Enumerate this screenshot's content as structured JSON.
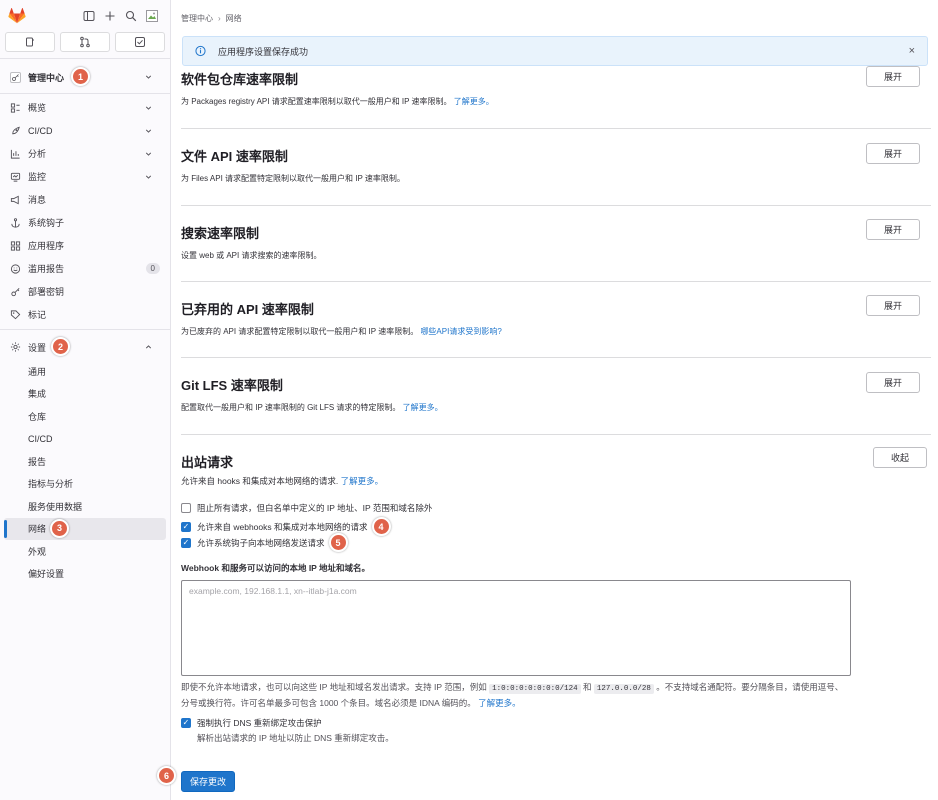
{
  "sidebar": {
    "top_icons": [
      "sidebar-toggle-icon",
      "plus-icon",
      "search-icon",
      "avatar"
    ],
    "quick_buttons": [
      "issues-icon",
      "merge-request-icon",
      "todo-icon"
    ],
    "admin": {
      "label": "管理中心",
      "marker": "1"
    },
    "items": [
      {
        "label": "概览",
        "icon": "overview-icon",
        "chevron": true
      },
      {
        "label": "CI/CD",
        "icon": "rocket-icon",
        "chevron": true
      },
      {
        "label": "分析",
        "icon": "chart-icon",
        "chevron": true
      },
      {
        "label": "监控",
        "icon": "monitor-icon",
        "chevron": true
      },
      {
        "label": "消息",
        "icon": "bullhorn-icon"
      },
      {
        "label": "系统钩子",
        "icon": "anchor-icon"
      },
      {
        "label": "应用程序",
        "icon": "applications-icon"
      },
      {
        "label": "滥用报告",
        "icon": "slight-smile-icon",
        "count": "0"
      },
      {
        "label": "部署密钥",
        "icon": "key-icon"
      },
      {
        "label": "标记",
        "icon": "label-icon"
      }
    ],
    "settings": {
      "label": "设置",
      "marker": "2"
    },
    "settings_items": [
      "通用",
      "集成",
      "仓库",
      "CI/CD",
      "报告",
      "指标与分析",
      "服务使用数据",
      "网络",
      "外观",
      "偏好设置"
    ],
    "active_marker": "3"
  },
  "breadcrumb": {
    "parent": "管理中心",
    "current": "网络"
  },
  "alert": {
    "text": "应用程序设置保存成功"
  },
  "sections": [
    {
      "title": "软件包仓库速率限制",
      "desc": "为 Packages registry API 请求配置速率限制以取代一般用户和 IP 速率限制。",
      "link": "了解更多。",
      "button": "展开"
    },
    {
      "title": "文件 API 速率限制",
      "desc": "为 Files API 请求配置特定限制以取代一般用户和 IP 速率限制。",
      "link": "",
      "button": "展开"
    },
    {
      "title": "搜索速率限制",
      "desc": "设置 web 或 API 请求搜索的速率限制。",
      "link": "",
      "button": "展开"
    },
    {
      "title": "已弃用的 API 速率限制",
      "desc": "为已废弃的 API 请求配置特定限制以取代一般用户和 IP 速率限制。",
      "link": "哪些API请求受到影响?",
      "button": "展开"
    },
    {
      "title": "Git LFS 速率限制",
      "desc": "配置取代一般用户和 IP 速率限制的 Git LFS 请求的特定限制。",
      "link": "了解更多。",
      "button": "展开"
    }
  ],
  "outbound": {
    "title": "出站请求",
    "desc": "允许来自 hooks 和集成对本地网络的请求.",
    "link": "了解更多。",
    "button": "收起",
    "checkboxes": [
      {
        "label": "阻止所有请求，但白名单中定义的 IP 地址、IP 范围和域名除外",
        "checked": false
      },
      {
        "label": "允许来自 webhooks 和集成对本地网络的请求",
        "checked": true,
        "marker": "4"
      },
      {
        "label": "允许系统钩子向本地网络发送请求",
        "checked": true,
        "marker": "5"
      }
    ],
    "allowlist_label": "Webhook 和服务可以访问的本地 IP 地址和域名。",
    "allowlist_placeholder": "example.com, 192.168.1.1, xn--itlab-j1a.com",
    "help_1": "即使不允许本地请求，也可以向这些 IP 地址和域名发出请求。支持 IP 范围，例如",
    "code_1": "1:0:0:0:0:0:0:0/124",
    "help_and": "和",
    "code_2": "127.0.0.0/28",
    "help_2": "。不支持域名通配符。要分隔条目，请使用逗号、分号或换行符。许可名单最多可包含 1000 个条目。域名必须是 IDNA 编码的。",
    "help_link": "了解更多。",
    "dns_label": "强制执行 DNS 重新绑定攻击保护",
    "dns_help": "解析出站请求的 IP 地址以防止 DNS 重新绑定攻击。"
  },
  "save": {
    "label": "保存更改",
    "marker": "6"
  },
  "colors": {
    "accent": "#1f75cb",
    "marker": "#e0634a",
    "logo": "#e24329"
  }
}
